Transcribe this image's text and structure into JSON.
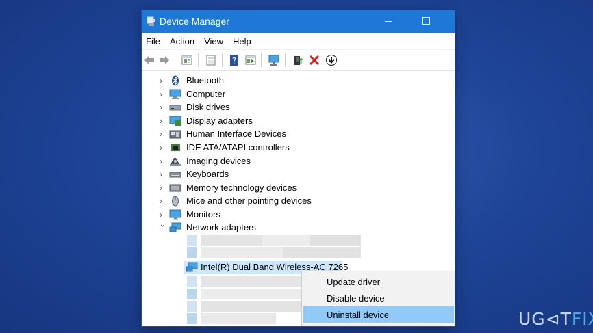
{
  "window": {
    "title": "Device Manager"
  },
  "menu": [
    "File",
    "Action",
    "View",
    "Help"
  ],
  "toolbar": [
    {
      "name": "back-icon"
    },
    {
      "name": "forward-icon"
    },
    {
      "name": "properties-icon"
    },
    {
      "name": "list-view-icon"
    },
    {
      "name": "help-icon"
    },
    {
      "name": "details-view-icon"
    },
    {
      "name": "scan-hardware-icon"
    },
    {
      "name": "update-driver-icon"
    },
    {
      "name": "uninstall-icon"
    },
    {
      "name": "disable-device-icon"
    }
  ],
  "tree": [
    {
      "label": "Bluetooth",
      "icon": "bluetooth-icon",
      "expanded": false
    },
    {
      "label": "Computer",
      "icon": "computer-icon",
      "expanded": false
    },
    {
      "label": "Disk drives",
      "icon": "disk-drive-icon",
      "expanded": false
    },
    {
      "label": "Display adapters",
      "icon": "display-adapter-icon",
      "expanded": false
    },
    {
      "label": "Human Interface Devices",
      "icon": "hid-icon",
      "expanded": false
    },
    {
      "label": "IDE ATA/ATAPI controllers",
      "icon": "ide-controller-icon",
      "expanded": false
    },
    {
      "label": "Imaging devices",
      "icon": "camera-icon",
      "expanded": false
    },
    {
      "label": "Keyboards",
      "icon": "keyboard-icon",
      "expanded": false
    },
    {
      "label": "Memory technology devices",
      "icon": "memory-icon",
      "expanded": false
    },
    {
      "label": "Mice and other pointing devices",
      "icon": "mouse-icon",
      "expanded": false
    },
    {
      "label": "Monitors",
      "icon": "monitor-icon",
      "expanded": false
    },
    {
      "label": "Network adapters",
      "icon": "network-adapter-icon",
      "expanded": true
    }
  ],
  "selected_device": "Intel(R) Dual Band Wireless-AC 7265",
  "context_menu": {
    "items": [
      "Update driver",
      "Disable device",
      "Uninstall device"
    ],
    "highlighted": "Uninstall device"
  },
  "watermark": {
    "prefix": "UG",
    "mid": "⊲T",
    "suffix": "FIX"
  },
  "colors": {
    "titlebar": "#1e78d6",
    "highlight": "#91c9f7",
    "background": "#1f4598"
  }
}
